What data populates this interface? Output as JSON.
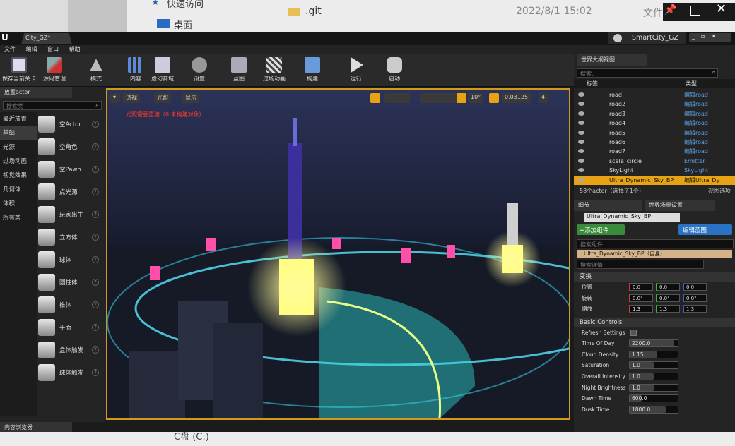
{
  "bg": {
    "quick_access": "快速访问",
    "desktop": "桌面",
    "git_file": ".git",
    "git_date": "2022/8/1 15:02",
    "git_type": "文件夹",
    "bottom_text": "C盘 (C:)"
  },
  "window": {
    "doc_tab": "City_GZ*",
    "project": "SmartCity_GZ"
  },
  "menu": [
    "文件",
    "编辑",
    "窗口",
    "帮助"
  ],
  "toolbar": [
    {
      "label": "保存当前关卡",
      "icon": "save-icon"
    },
    {
      "label": "源码管理",
      "icon": "source-control-icon"
    },
    {
      "label": "模式",
      "icon": "modes-icon"
    },
    {
      "label": "内容",
      "icon": "content-icon"
    },
    {
      "label": "虚幻商城",
      "icon": "marketplace-icon"
    },
    {
      "label": "设置",
      "icon": "settings-icon"
    },
    {
      "label": "蓝图",
      "icon": "blueprint-icon"
    },
    {
      "label": "过场动画",
      "icon": "cinematics-icon"
    },
    {
      "label": "构建",
      "icon": "build-icon"
    },
    {
      "label": "运行",
      "icon": "play-icon"
    },
    {
      "label": "启动",
      "icon": "launch-icon"
    }
  ],
  "place": {
    "tab": "放置actor",
    "search": "搜索类",
    "categories": [
      "最近放置",
      "基础",
      "光源",
      "过场动画",
      "视觉效果",
      "几何体",
      "体积",
      "所有类"
    ],
    "selected_category": 1,
    "items": [
      "空Actor",
      "空角色",
      "空Pawn",
      "点光源",
      "玩家出生",
      "立方体",
      "球体",
      "圆柱体",
      "椎体",
      "平面",
      "盒体触发",
      "球体触发"
    ]
  },
  "viewport": {
    "perspective": "透视",
    "lit": "光照",
    "show": "显示",
    "warning": "光照需要重建（0 未构建对象）",
    "snap_angle": "10°",
    "scale": "0.03125",
    "camera_speed": "4"
  },
  "content_browser": "内容浏览器",
  "outliner": {
    "tab": "世界大纲视图",
    "search": "搜索...",
    "col_label": "标签",
    "col_type": "类型",
    "rows": [
      {
        "name": "road",
        "type": "编辑road"
      },
      {
        "name": "road2",
        "type": "编辑road"
      },
      {
        "name": "road3",
        "type": "编辑road"
      },
      {
        "name": "road4",
        "type": "编辑road"
      },
      {
        "name": "road5",
        "type": "编辑road"
      },
      {
        "name": "road6",
        "type": "编辑road"
      },
      {
        "name": "road7",
        "type": "编辑road"
      },
      {
        "name": "scale_circle",
        "type": "Emitter"
      },
      {
        "name": "SkyLight",
        "type": "SkyLight"
      },
      {
        "name": "Ultra_Dynamic_Sky_BP",
        "type": "编辑Ultra_Dy"
      }
    ],
    "footer": "58个actor（选择了1个）",
    "view_options": "视图选项"
  },
  "details": {
    "tab_details": "细节",
    "tab_world": "世界场景设置",
    "actor_name": "Ultra_Dynamic_Sky_BP",
    "add_component": "+添加组件",
    "edit_blueprint": "编辑蓝图",
    "search_components": "搜索组件",
    "self": "Ultra_Dynamic_Sky_BP（自身）",
    "search_details": "搜索详情",
    "transform": "变换",
    "location_label": "位置",
    "rotation_label": "旋转",
    "scale_label": "缩放",
    "location": [
      "0.0",
      "0.0",
      "0.0"
    ],
    "rotation": [
      "0.0°",
      "0.0°",
      "0.0°"
    ],
    "scale": [
      "1.3",
      "1.3",
      "1.3"
    ],
    "basic_controls": "Basic Controls",
    "props": [
      {
        "label": "Refresh Settings",
        "value": "",
        "fill": 0
      },
      {
        "label": "Time Of Day",
        "value": "2200.0",
        "fill": 0.92
      },
      {
        "label": "Cloud Density",
        "value": "1.15",
        "fill": 0.58
      },
      {
        "label": "Saturation",
        "value": "1.0",
        "fill": 0.5
      },
      {
        "label": "Overall Intensity",
        "value": "1.0",
        "fill": 0.5
      },
      {
        "label": "Night Brightness",
        "value": "1.0",
        "fill": 0.5
      },
      {
        "label": "Dawn Time",
        "value": "600.0",
        "fill": 0.25
      },
      {
        "label": "Dusk Time",
        "value": "1800.0",
        "fill": 0.75
      }
    ]
  }
}
